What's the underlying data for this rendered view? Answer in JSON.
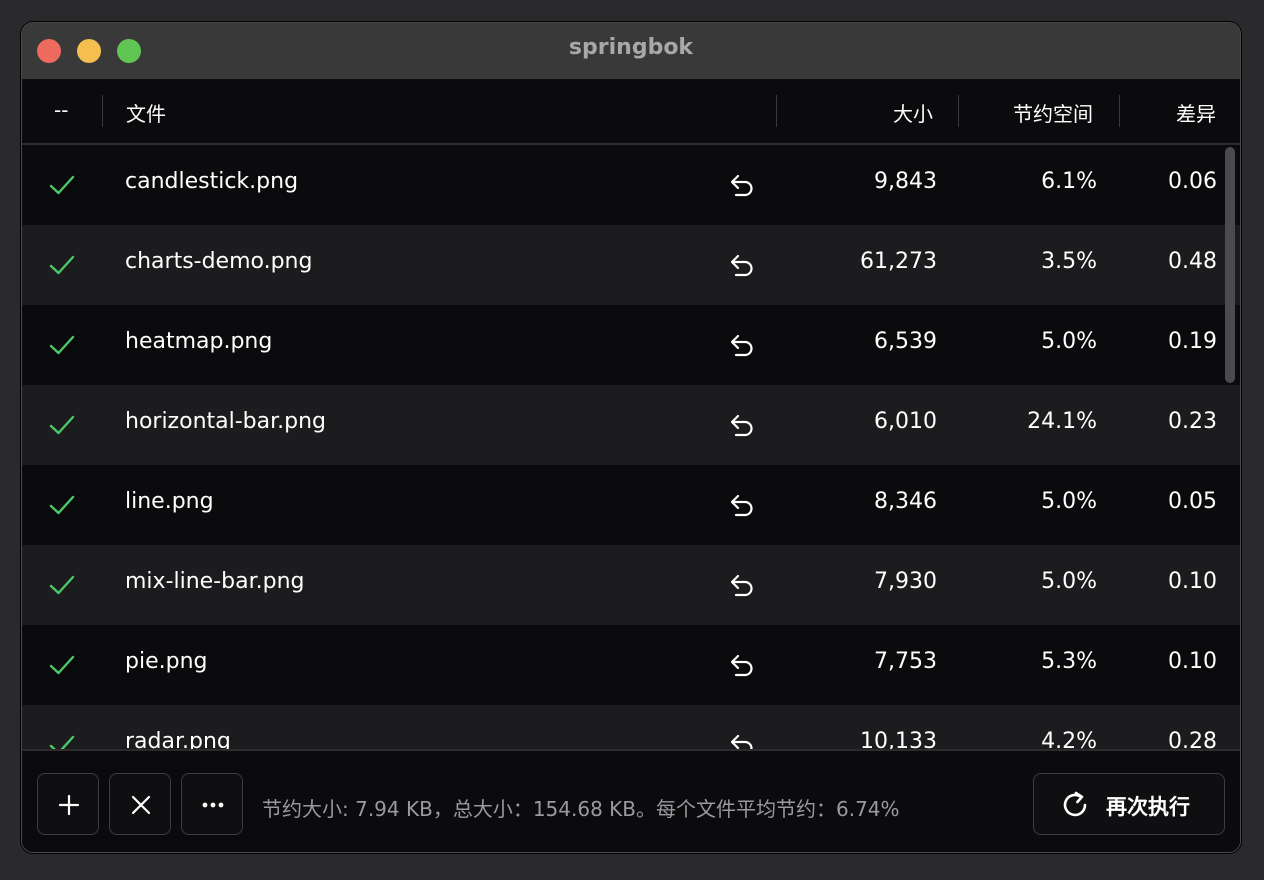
{
  "window": {
    "title": "springbok"
  },
  "header": {
    "status_col": "--",
    "file_col": "文件",
    "size_col": "大小",
    "savings_col": "节约空间",
    "diff_col": "差异"
  },
  "rows": [
    {
      "name": "candlestick.png",
      "size": "9,843",
      "savings": "6.1%",
      "diff": "0.06"
    },
    {
      "name": "charts-demo.png",
      "size": "61,273",
      "savings": "3.5%",
      "diff": "0.48"
    },
    {
      "name": "heatmap.png",
      "size": "6,539",
      "savings": "5.0%",
      "diff": "0.19"
    },
    {
      "name": "horizontal-bar.png",
      "size": "6,010",
      "savings": "24.1%",
      "diff": "0.23"
    },
    {
      "name": "line.png",
      "size": "8,346",
      "savings": "5.0%",
      "diff": "0.05"
    },
    {
      "name": "mix-line-bar.png",
      "size": "7,930",
      "savings": "5.0%",
      "diff": "0.10"
    },
    {
      "name": "pie.png",
      "size": "7,753",
      "savings": "5.3%",
      "diff": "0.10"
    },
    {
      "name": "radar.png",
      "size": "10,133",
      "savings": "4.2%",
      "diff": "0.28"
    }
  ],
  "footer": {
    "status": "节约大小: 7.94 KB，总大小：154.68 KB。每个文件平均节约：6.74%",
    "rerun_label": "再次执行"
  },
  "icons": {
    "row_status": "check-icon",
    "row_action": "revert-arrow-icon",
    "add": "plus-icon",
    "clear": "x-icon",
    "more": "ellipsis-icon",
    "rerun": "refresh-icon"
  },
  "colors": {
    "check": "#4cc76a",
    "window_bg": "#0b0b0d",
    "row_alt": "#1c1c1e",
    "titlebar": "#39393a",
    "close": "#ec6a5e",
    "minimize": "#f4bf4f",
    "maximize": "#61c554"
  }
}
